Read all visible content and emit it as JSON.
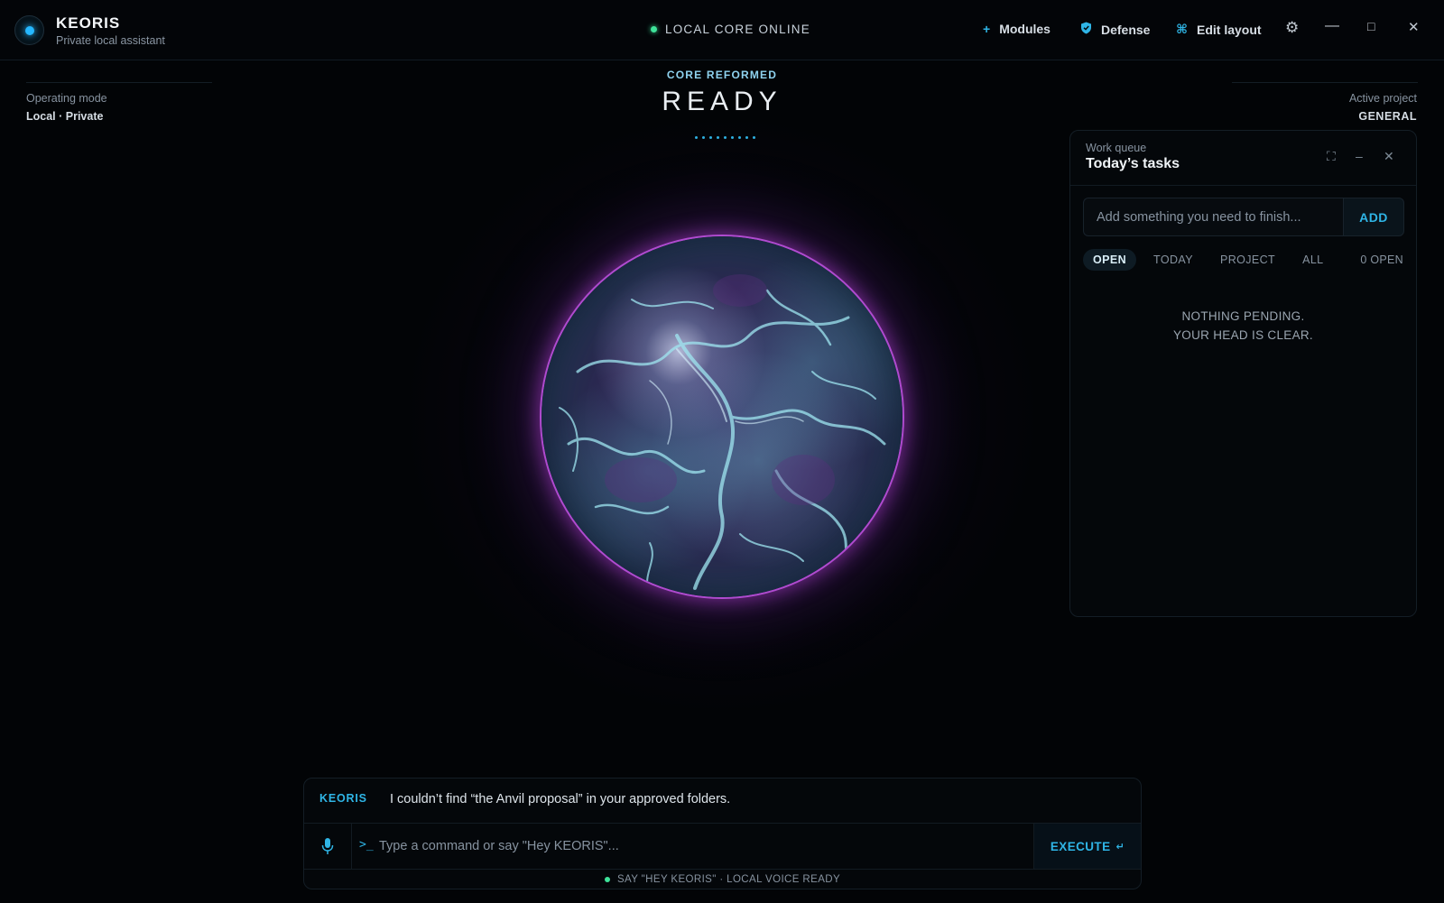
{
  "header": {
    "app_name": "KEORIS",
    "app_subtitle": "Private local assistant",
    "status": "LOCAL CORE ONLINE",
    "modules_label": "Modules",
    "defense_label": "Defense",
    "edit_layout_label": "Edit layout",
    "icons": {
      "modules": "plus-icon",
      "defense": "shield-icon",
      "edit_layout": "command-icon",
      "settings": "gear-icon",
      "minimize": "minimize-icon",
      "maximize": "maximize-icon",
      "close": "close-icon"
    }
  },
  "left_info": {
    "label": "Operating mode",
    "value": "Local · Private"
  },
  "right_info": {
    "label": "Active project",
    "value": "GENERAL"
  },
  "core": {
    "kicker": "CORE REFORMED",
    "state": "READY"
  },
  "task_panel": {
    "kicker": "Work queue",
    "title": "Today’s tasks",
    "input_placeholder": "Add something you need to finish...",
    "add_label": "ADD",
    "filters": [
      "OPEN",
      "TODAY",
      "PROJECT",
      "ALL"
    ],
    "active_filter": "OPEN",
    "open_count": "0 OPEN",
    "empty_line1": "NOTHING PENDING.",
    "empty_line2": "YOUR HEAD IS CLEAR."
  },
  "console": {
    "reply_from": "KEORIS",
    "reply_text": "I couldn’t find “the Anvil proposal” in your approved folders.",
    "input_placeholder": "Type a command or say \"Hey KEORIS\"...",
    "prompt_glyph": ">_",
    "execute_label": "EXECUTE",
    "execute_glyph": "↵",
    "voice_status": "SAY \"HEY KEORIS\" · LOCAL VOICE READY"
  },
  "colors": {
    "accent": "#2fb5e6",
    "online": "#3ee39a",
    "orb_rim": "#b04bd0",
    "background": "#020406"
  }
}
